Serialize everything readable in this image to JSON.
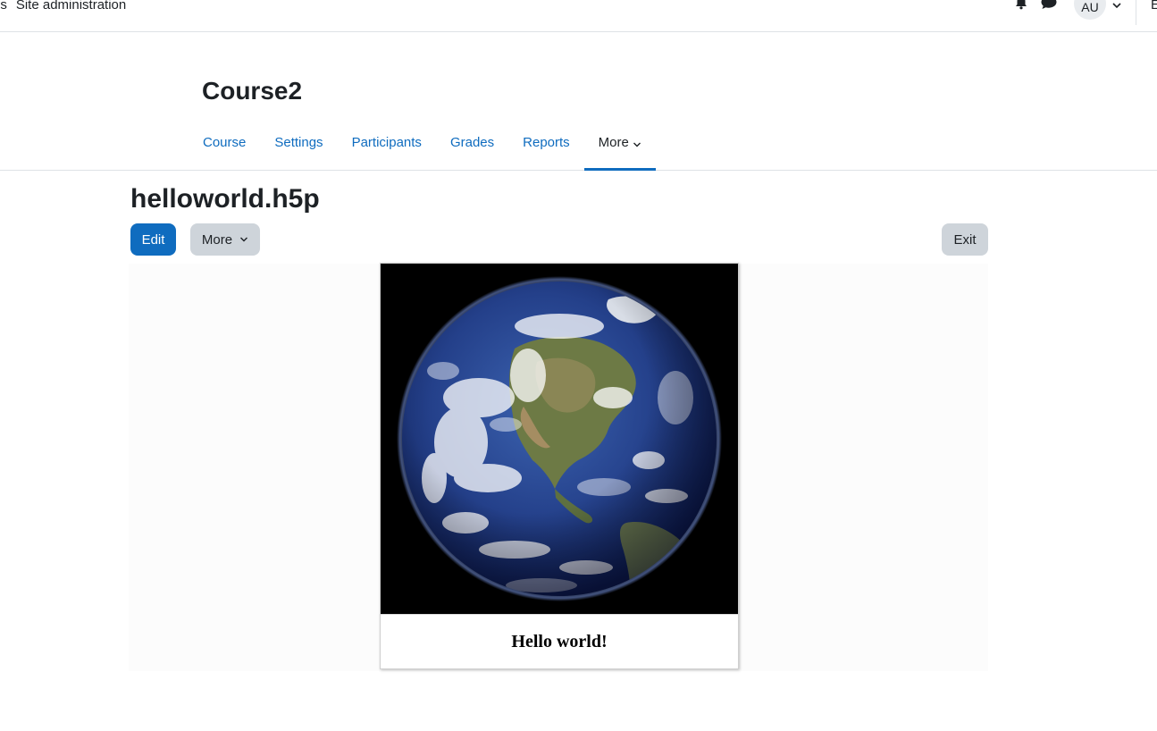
{
  "topnav": {
    "items": [
      "es",
      "Site administration"
    ],
    "avatar_initials": "AU",
    "edge_text": "E"
  },
  "course": {
    "title": "Course2",
    "tabs": [
      "Course",
      "Settings",
      "Participants",
      "Grades",
      "Reports"
    ],
    "more_tab_label": "More",
    "active_tab": "More"
  },
  "activity": {
    "title": "helloworld.h5p",
    "edit_label": "Edit",
    "more_label": "More",
    "exit_label": "Exit"
  },
  "h5p": {
    "image_subject": "earth-globe",
    "caption": "Hello world!"
  },
  "colors": {
    "primary": "#0f6cbf",
    "secondary_button": "#ced4da",
    "text": "#1d2125"
  }
}
